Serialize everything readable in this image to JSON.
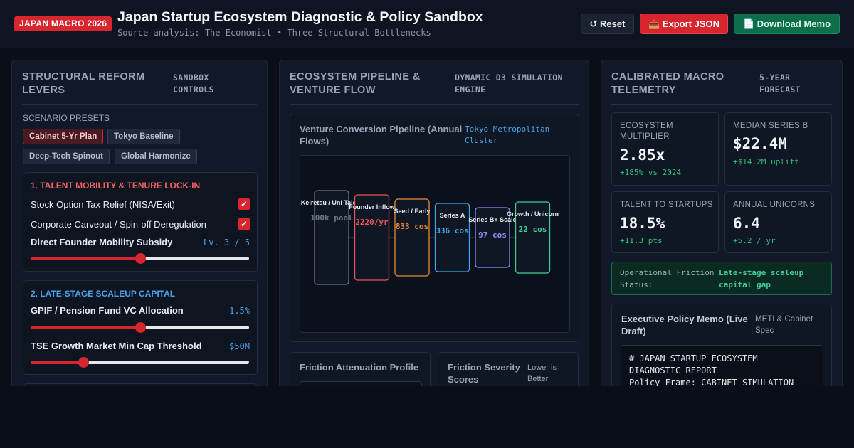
{
  "header": {
    "badge": "JAPAN MACRO 2026",
    "title": "Japan Startup Ecosystem Diagnostic & Policy Sandbox",
    "subtitle": "Source analysis: The Economist • Three Structural Bottlenecks",
    "buttons": {
      "reset": "↺ Reset",
      "export": "📤 Export JSON",
      "memo": "📄 Download Memo"
    }
  },
  "left": {
    "title": "STRUCTURAL REFORM LEVERS",
    "tag": "SANDBOX CONTROLS",
    "presets_label": "SCENARIO PRESETS",
    "presets": [
      "Cabinet 5-Yr Plan",
      "Tokyo Baseline",
      "Deep-Tech Spinout",
      "Global Harmonize"
    ],
    "active_preset": "Cabinet 5-Yr Plan",
    "talent": {
      "title": "1. TALENT MOBILITY & TENURE LOCK-IN",
      "option1": "Stock Option Tax Relief (NISA/Exit)",
      "option2": "Corporate Carveout / Spin-off Deregulation",
      "option1_checked": true,
      "option2_checked": true,
      "subsidy_label": "Direct Founder Mobility Subsidy",
      "subsidy_level": "Lv. 3 / 5",
      "subsidy_fraction": 0.5
    },
    "capital": {
      "title": "2. LATE-STAGE SCALEUP CAPITAL",
      "gpif_label": "GPIF / Pension Fund VC Allocation",
      "gpif_value": "1.5%",
      "gpif_fraction": 0.5,
      "tse_label": "TSE Growth Market Min Cap Threshold",
      "tse_value": "$50M",
      "tse_fraction": 0.24
    }
  },
  "middle": {
    "title": "ECOSYSTEM PIPELINE & VENTURE FLOW",
    "tag": "DYNAMIC D3 SIMULATION ENGINE",
    "pipeline": {
      "title": "Venture Conversion Pipeline (Annual Flows)",
      "tag": "Tokyo Metropolitan Cluster",
      "stages": [
        {
          "label": "Keiretsu / Uni Talent",
          "value": "100k pool",
          "color": "#6b7488",
          "count": 100000
        },
        {
          "label": "Founder Inflow",
          "value": "2220/yr",
          "color": "#e8555c",
          "count": 2220
        },
        {
          "label": "Seed / Early",
          "value": "833 cos",
          "color": "#e8893a",
          "count": 833
        },
        {
          "label": "Series A",
          "value": "336 cos",
          "color": "#3fa4e8",
          "count": 336
        },
        {
          "label": "Series B+ Scale",
          "value": "97 cos",
          "color": "#8b8ff2",
          "count": 97
        },
        {
          "label": "Growth / Unicorn",
          "value": "22 cos",
          "color": "#3ecf95",
          "count": 22
        }
      ]
    },
    "friction_profile": {
      "title": "Friction Attenuation Profile"
    },
    "friction_scores": {
      "title": "Friction Severity Scores",
      "tag": "Lower is Better"
    }
  },
  "right": {
    "title": "CALIBRATED MACRO TELEMETRY",
    "tag": "5-YEAR FORECAST",
    "metrics": [
      {
        "label": "ECOSYSTEM MULTIPLIER",
        "value": "2.85x",
        "delta": "+185% vs 2024"
      },
      {
        "label": "MEDIAN SERIES B",
        "value": "$22.4M",
        "delta": "+$14.2M uplift"
      },
      {
        "label": "TALENT TO STARTUPS",
        "value": "18.5%",
        "delta": "+11.3 pts"
      },
      {
        "label": "ANNUAL UNICORNS",
        "value": "6.4",
        "delta": "+5.2 / yr"
      }
    ],
    "status_label": "Operational Friction Status:",
    "status_value": "Late-stage scaleup capital gap",
    "memo": {
      "title": "Executive Policy Memo (Live Draft)",
      "tag": "METI & Cabinet Spec",
      "text": "# JAPAN STARTUP ECOSYSTEM\nDIAGNOSTIC REPORT\nPolicy Frame: CABINET SIMULATION"
    }
  },
  "colors": {
    "accent_red": "#d7262e",
    "accent_green": "#2fbf7c",
    "accent_blue": "#4aa3e8",
    "talent_title": "#f0625f",
    "capital_title": "#4aa3e8"
  }
}
